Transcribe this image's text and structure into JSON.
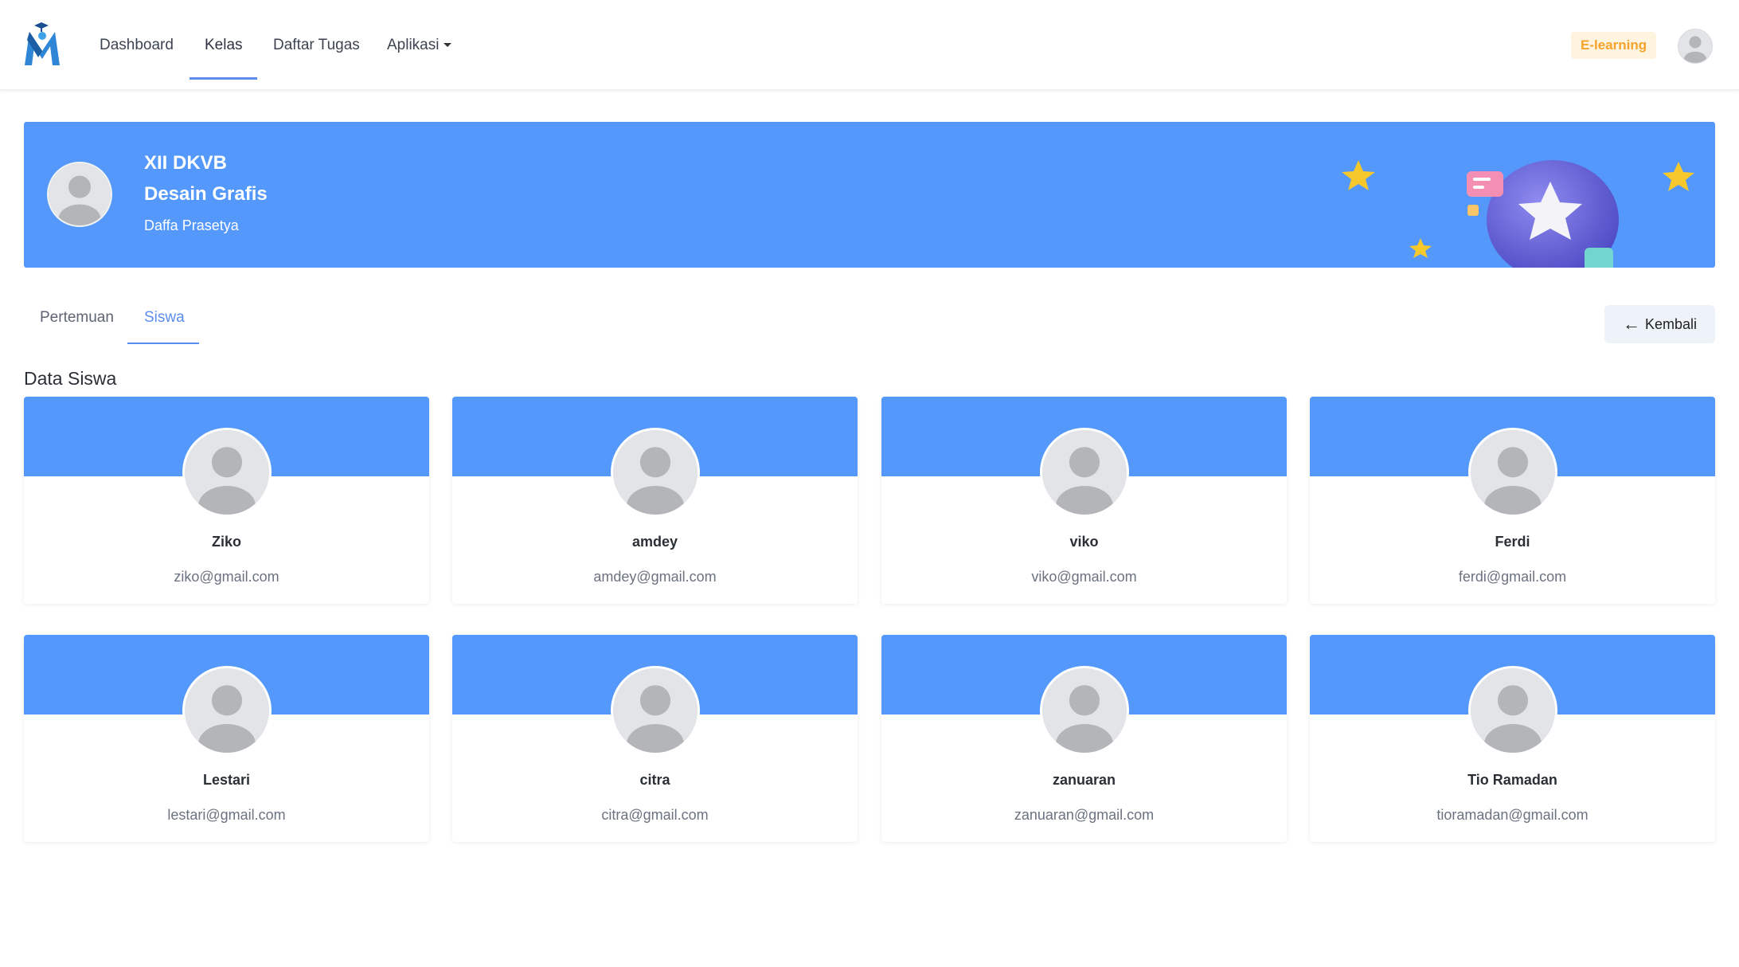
{
  "nav": {
    "items": [
      "Dashboard",
      "Kelas",
      "Daftar Tugas",
      "Aplikasi"
    ],
    "active": "Kelas",
    "badge": "E-learning",
    "accent_color": "#5b8def",
    "badge_color": "#f5a32a"
  },
  "banner": {
    "class_name": "XII DKVB",
    "subject": "Desain Grafis",
    "teacher": "Daffa Prasetya",
    "background_color": "#5398fa",
    "decoration_icons": [
      "star-icon",
      "planet-icon",
      "chat-bubble-icon"
    ]
  },
  "tabs": {
    "items": [
      "Pertemuan",
      "Siswa"
    ],
    "active": "Siswa"
  },
  "back_button": {
    "label": "Kembali",
    "icon": "arrow-left-icon"
  },
  "section_title": "Data Siswa",
  "students": [
    {
      "name": "Ziko",
      "email": "ziko@gmail.com"
    },
    {
      "name": "amdey",
      "email": "amdey@gmail.com"
    },
    {
      "name": "viko",
      "email": "viko@gmail.com"
    },
    {
      "name": "Ferdi",
      "email": "ferdi@gmail.com"
    },
    {
      "name": "Lestari",
      "email": "lestari@gmail.com"
    },
    {
      "name": "citra",
      "email": "citra@gmail.com"
    },
    {
      "name": "zanuaran",
      "email": "zanuaran@gmail.com"
    },
    {
      "name": "Tio Ramadan",
      "email": "tioramadan@gmail.com"
    }
  ]
}
